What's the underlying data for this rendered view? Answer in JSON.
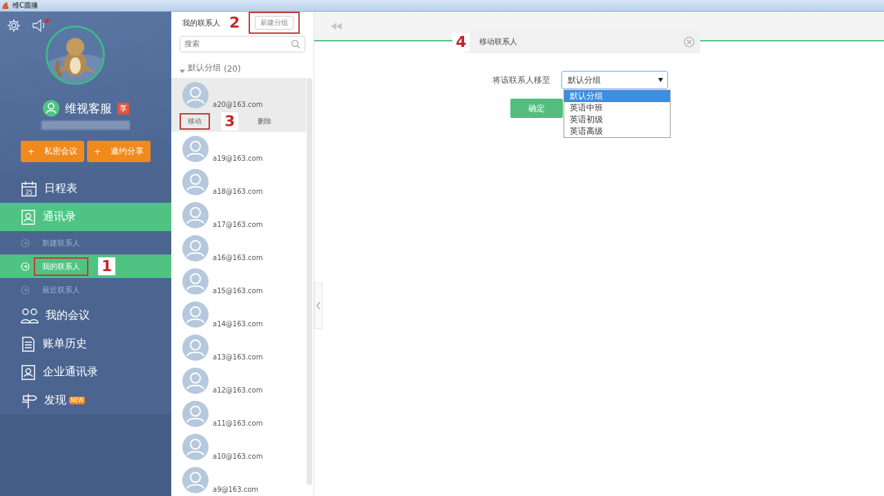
{
  "window": {
    "title": "维C圆播"
  },
  "sidebar": {
    "sound": {
      "unread": true
    },
    "profile": {
      "name": "维视客服",
      "badge": "享",
      "buttons": [
        {
          "plus": "+",
          "label": "私密会议"
        },
        {
          "plus": "+",
          "label": "邀约分享"
        }
      ]
    },
    "nav": [
      {
        "label": "日程表",
        "kind": "calendar",
        "icon_text": "25",
        "selected": false
      },
      {
        "label": "通讯录",
        "kind": "contacts",
        "selected": true,
        "children": [
          {
            "label": "新建联系人",
            "selected": false,
            "annotated": false
          },
          {
            "label": "我的联系人",
            "selected": true,
            "annotated": true,
            "callout": "1"
          },
          {
            "label": "最近联系人",
            "selected": false,
            "annotated": false
          }
        ]
      },
      {
        "label": "我的会议",
        "kind": "meeting",
        "selected": false
      },
      {
        "label": "账单历史",
        "kind": "bill",
        "selected": false
      },
      {
        "label": "企业通讯录",
        "kind": "contacts",
        "selected": false
      },
      {
        "label": "发现",
        "kind": "signpost",
        "badge": "NEW",
        "selected": false
      }
    ]
  },
  "contacts_panel": {
    "title": "我的联系人",
    "new_group_button": {
      "label": "新建分组",
      "annotated": true,
      "callout": "2"
    },
    "search": {
      "placeholder": "搜索"
    },
    "group": {
      "label": "默认分组",
      "count": "(20)",
      "expanded": true
    },
    "contacts": [
      {
        "email": "a20@163.com",
        "selected": true,
        "actions": [
          {
            "label": "移动",
            "annotated": true,
            "callout": "3"
          },
          {
            "label": "删除",
            "annotated": false
          }
        ]
      },
      {
        "email": "a19@163.com",
        "selected": false
      },
      {
        "email": "a18@163.com",
        "selected": false
      },
      {
        "email": "a17@163.com",
        "selected": false
      },
      {
        "email": "a16@163.com",
        "selected": false
      },
      {
        "email": "a15@163.com",
        "selected": false
      },
      {
        "email": "a14@163.com",
        "selected": false
      },
      {
        "email": "a13@163.com",
        "selected": false
      },
      {
        "email": "a12@163.com",
        "selected": false
      },
      {
        "email": "a11@163.com",
        "selected": false
      },
      {
        "email": "a10@163.com",
        "selected": false
      },
      {
        "email": "a9@163.com",
        "selected": false
      }
    ]
  },
  "dialog": {
    "title": "移动联系人",
    "callout": "4",
    "label": "将该联系人移至",
    "select": {
      "value": "默认分组",
      "expanded": true,
      "options": [
        {
          "label": "默认分组",
          "selected": true
        },
        {
          "label": "英语中班",
          "selected": false
        },
        {
          "label": "英语初级",
          "selected": false
        },
        {
          "label": "英语高级",
          "selected": false
        }
      ]
    },
    "confirm": "确定"
  }
}
